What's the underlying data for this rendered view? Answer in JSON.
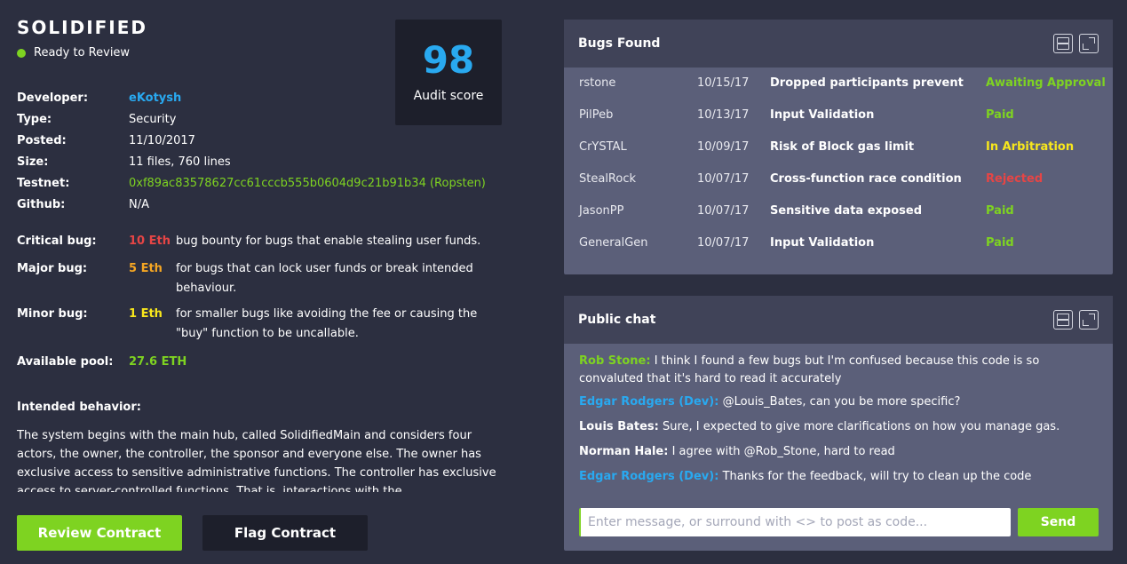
{
  "brand": "SOLIDIFIED",
  "status": "Ready to Review",
  "audit": {
    "score": "98",
    "label": "Audit score"
  },
  "info": {
    "developer": {
      "key": "Developer:",
      "value": "eKotysh"
    },
    "type": {
      "key": "Type:",
      "value": "Security"
    },
    "posted": {
      "key": "Posted:",
      "value": "11/10/2017"
    },
    "size": {
      "key": "Size:",
      "value": "11 files, 760 lines"
    },
    "testnet": {
      "key": "Testnet:",
      "value": "0xf89ac83578627cc61cccb555b0604d9c21b91b34 (Ropsten)"
    },
    "github": {
      "key": "Github:",
      "value": "N/A"
    }
  },
  "bounties": {
    "critical": {
      "key": "Critical bug:",
      "amount": "10 Eth",
      "desc": "bug bounty for bugs that enable stealing user funds."
    },
    "major": {
      "key": "Major bug:",
      "amount": "5 Eth",
      "desc": "for bugs that can lock user funds or break intended behaviour."
    },
    "minor": {
      "key": "Minor bug:",
      "amount": "1 Eth",
      "desc": "for smaller bugs like avoiding the fee or causing the \"buy\" function to be uncallable."
    },
    "pool": {
      "key": "Available pool:",
      "amount": "27.6 ETH"
    }
  },
  "intended": {
    "title": "Intended behavior:",
    "text": "The system begins with the main hub, called SolidifiedMain and considers four actors, the owner, the controller, the sponsor and everyone else. The owner has exclusive access to sensitive administrative functions. The controller has exclusive access to server-controlled functions. That is, interactions with the"
  },
  "buttons": {
    "review": "Review Contract",
    "flag": "Flag Contract"
  },
  "bugs_panel": {
    "title": "Bugs Found",
    "rows": [
      {
        "user": "rstone",
        "date": "10/15/17",
        "title": "Dropped participants prevent",
        "status": "Awaiting Approval"
      },
      {
        "user": "PilPeb",
        "date": "10/13/17",
        "title": "Input Validation",
        "status": "Paid"
      },
      {
        "user": "CrYSTAL",
        "date": "10/09/17",
        "title": "Risk of Block gas limit",
        "status": "In Arbitration"
      },
      {
        "user": "StealRock",
        "date": "10/07/17",
        "title": "Cross-function race condition",
        "status": "Rejected"
      },
      {
        "user": "JasonPP",
        "date": "10/07/17",
        "title": "Sensitive data exposed",
        "status": "Paid"
      },
      {
        "user": "GeneralGen",
        "date": "10/07/17",
        "title": "Input Validation",
        "status": "Paid"
      }
    ]
  },
  "chat_panel": {
    "title": "Public chat",
    "messages": [
      {
        "author": "Rob Stone:",
        "text": "I think I found a few bugs but I'm confused because this code is so convaluted that it's hard to read it accurately"
      },
      {
        "author": "Edgar Rodgers (Dev):",
        "text": "@Louis_Bates, can you be more specific?"
      },
      {
        "author": "Louis Bates:",
        "text": "Sure, I expected to give more clarifications on how you manage gas."
      },
      {
        "author": "Norman Hale:",
        "text": "I agree with @Rob_Stone, hard to read"
      },
      {
        "author": "Edgar Rodgers (Dev):",
        "text": "Thanks for the feedback, will try to clean up the code"
      }
    ],
    "input_placeholder": "Enter message, or surround with <> to post as code...",
    "send_label": "Send"
  },
  "colors": {
    "background": "#2c2f40",
    "accent_green": "#7ed321",
    "accent_blue": "#29a9f0",
    "critical_red": "#e64545",
    "major_orange": "#f5a623",
    "arbitration_yellow": "#f8e71c",
    "panel": "#5b5f79",
    "panel_header": "#404358"
  },
  "icons": [
    "split-view-icon",
    "expand-icon"
  ]
}
